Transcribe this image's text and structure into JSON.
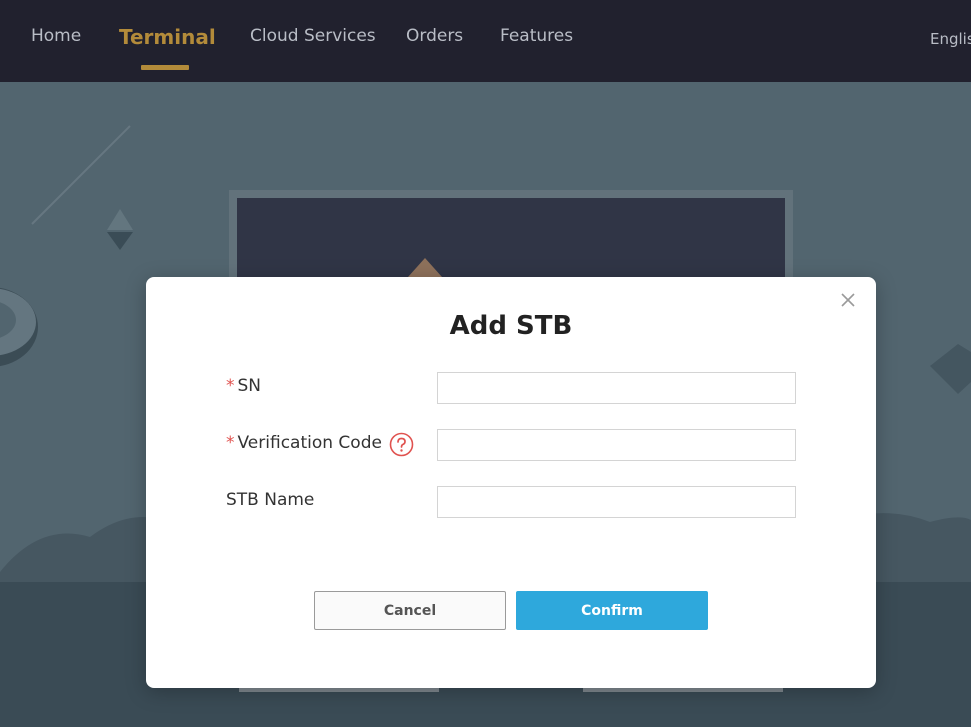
{
  "nav": {
    "items": [
      {
        "label": "Home",
        "active": false
      },
      {
        "label": "Terminal",
        "active": true
      },
      {
        "label": "Cloud Services",
        "active": false
      },
      {
        "label": "Orders",
        "active": false
      },
      {
        "label": "Features",
        "active": false
      }
    ],
    "language": "Englis",
    "active_color": "#b38b3a"
  },
  "modal": {
    "title": "Add STB",
    "close_icon": "close-icon",
    "fields": [
      {
        "label": "SN",
        "required": true,
        "value": "",
        "placeholder": ""
      },
      {
        "label": "Verification Code",
        "required": true,
        "value": "",
        "placeholder": "",
        "help_icon": "question-circle-icon"
      },
      {
        "label": "STB Name",
        "required": false,
        "value": "",
        "placeholder": ""
      }
    ],
    "required_mark": "*",
    "cancel_label": "Cancel",
    "confirm_label": "Confirm",
    "confirm_color": "#2ea8dc",
    "required_color": "#e0524f"
  }
}
